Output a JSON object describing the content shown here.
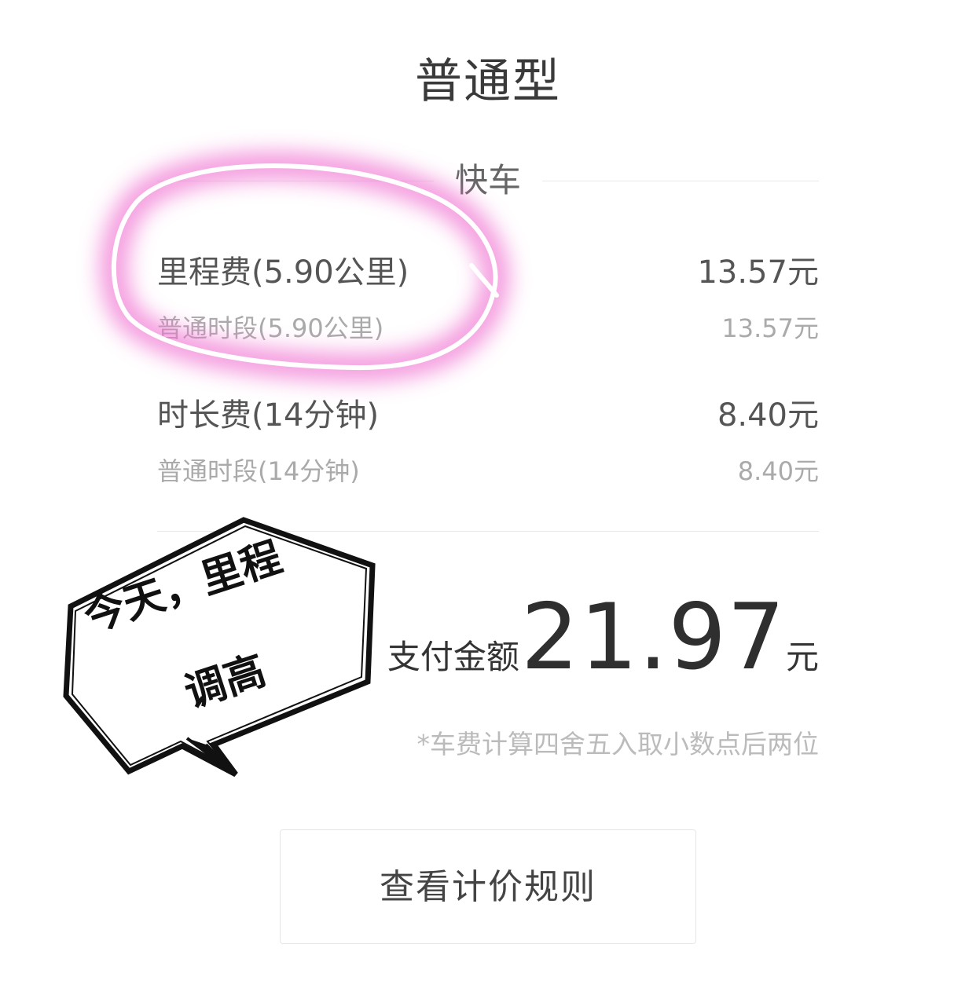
{
  "header": {
    "title": "普通型"
  },
  "section": {
    "label": "快车"
  },
  "fees": [
    {
      "label": "里程费(5.90公里)",
      "value": "13.57元",
      "detail_label": "普通时段(5.90公里)",
      "detail_value": "13.57元"
    },
    {
      "label": "时长费(14分钟)",
      "value": "8.40元",
      "detail_label": "普通时段(14分钟)",
      "detail_value": "8.40元"
    }
  ],
  "total": {
    "label": "支付金额",
    "amount": "21.97",
    "unit": "元"
  },
  "note": "*车费计算四舍五入取小数点后两位",
  "rules_button": {
    "label": "查看计价规则"
  },
  "annotation": {
    "line1": "今天，里程",
    "line2": "调高",
    "circle_color": "#f06fd0"
  }
}
